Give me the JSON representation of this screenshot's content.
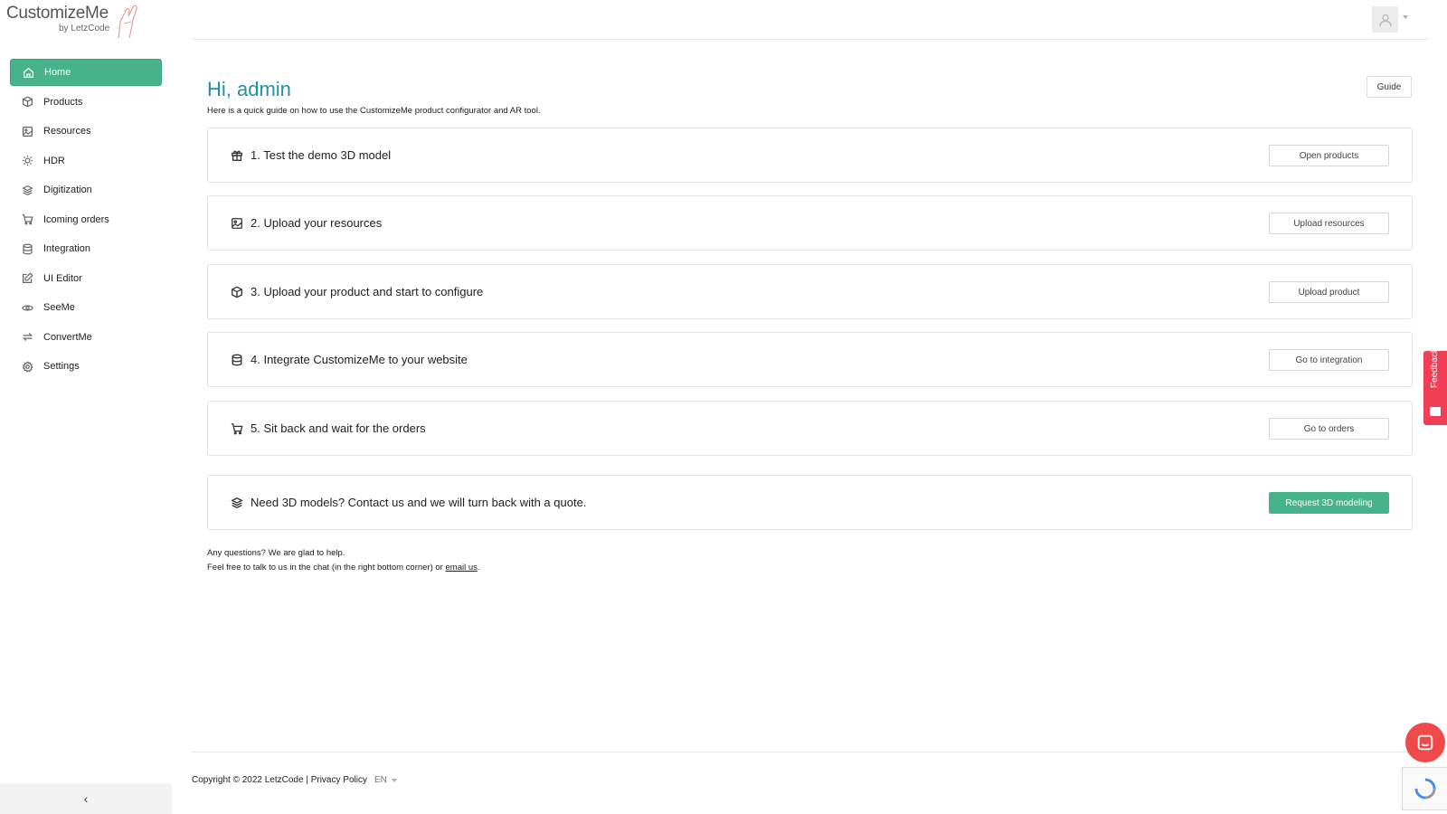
{
  "app": {
    "logo_text": "CustomizeMe",
    "logo_sub": "by LetzCode"
  },
  "sidebar": {
    "items": [
      {
        "label": "Home",
        "icon": "home-icon",
        "active": true
      },
      {
        "label": "Products",
        "icon": "cube-icon"
      },
      {
        "label": "Resources",
        "icon": "image-icon"
      },
      {
        "label": "HDR",
        "icon": "sun-icon"
      },
      {
        "label": "Digitization",
        "icon": "layers-icon"
      },
      {
        "label": "Icoming orders",
        "icon": "cart-icon"
      },
      {
        "label": "Integration",
        "icon": "database-icon"
      },
      {
        "label": "UI Editor",
        "icon": "edit-icon"
      },
      {
        "label": "SeeMe",
        "icon": "eye-icon"
      },
      {
        "label": "ConvertMe",
        "icon": "convert-icon"
      },
      {
        "label": "Settings",
        "icon": "gear-icon"
      }
    ],
    "collapse_glyph": "‹"
  },
  "main": {
    "greeting": "Hi, admin",
    "intro": "Here is a quick guide on how to use the CustomizeMe product configurator and AR tool.",
    "guide_label": "Guide",
    "steps": [
      {
        "title": "1. Test the demo 3D model",
        "button": "Open products",
        "icon": "gift-icon"
      },
      {
        "title": "2. Upload your resources",
        "button": "Upload resources",
        "icon": "image-icon"
      },
      {
        "title": "3. Upload your product and start to configure",
        "button": "Upload product",
        "icon": "cube-icon"
      },
      {
        "title": "4. Integrate CustomizeMe to your website",
        "button": "Go to integration",
        "icon": "database-icon"
      },
      {
        "title": "5. Sit back and wait for the orders",
        "button": "Go to orders",
        "icon": "cart-icon"
      }
    ],
    "request": {
      "title": "Need 3D models? Contact us and we will turn back with a quote.",
      "button": "Request 3D modeling",
      "icon": "layers-icon"
    },
    "help_line1": "Any questions? We are glad to help.",
    "help_line2_prefix": "Feel free to talk to us in the chat (in the right bottom corner) or ",
    "help_link": "email us",
    "help_line2_suffix": "."
  },
  "footer": {
    "copyright": "Copyright © 2022 LetzCode | Privacy Policy",
    "lang": "EN"
  },
  "feedback": {
    "label": "Feedback"
  },
  "colors": {
    "accent": "#46b38c",
    "greeting": "#1f93a3",
    "feedback": "#ef3e55",
    "chat": "#ef4a4a"
  }
}
